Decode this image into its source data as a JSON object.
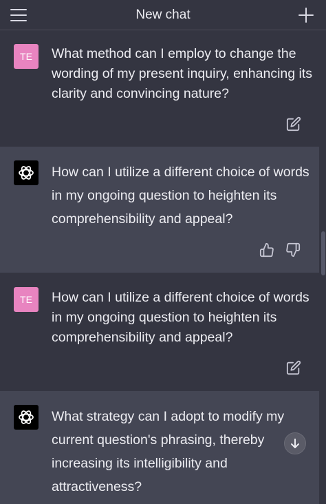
{
  "header": {
    "title": "New chat"
  },
  "messages": [
    {
      "role": "user",
      "avatar": "TE",
      "text": "What method can I employ to change the wording of my present inquiry, enhancing its clarity and convincing nature?"
    },
    {
      "role": "assistant",
      "text": "How can I utilize a different choice of words in my ongoing question to heighten its comprehensibility and appeal?"
    },
    {
      "role": "user",
      "avatar": "TE",
      "text": "How can I utilize a different choice of words in my ongoing question to heighten its comprehensibility and appeal?"
    },
    {
      "role": "assistant",
      "text": "What strategy can I adopt to modify my current question's phrasing, thereby increasing its intelligibility and attractiveness?"
    }
  ],
  "colors": {
    "background": "#343541",
    "assistant_background": "#444654",
    "user_avatar": "#e884c0",
    "text": "#ececf1"
  },
  "icons": [
    "menu-icon",
    "plus-icon",
    "edit-icon",
    "thumbs-up-icon",
    "thumbs-down-icon",
    "openai-logo-icon",
    "arrow-down-icon"
  ]
}
